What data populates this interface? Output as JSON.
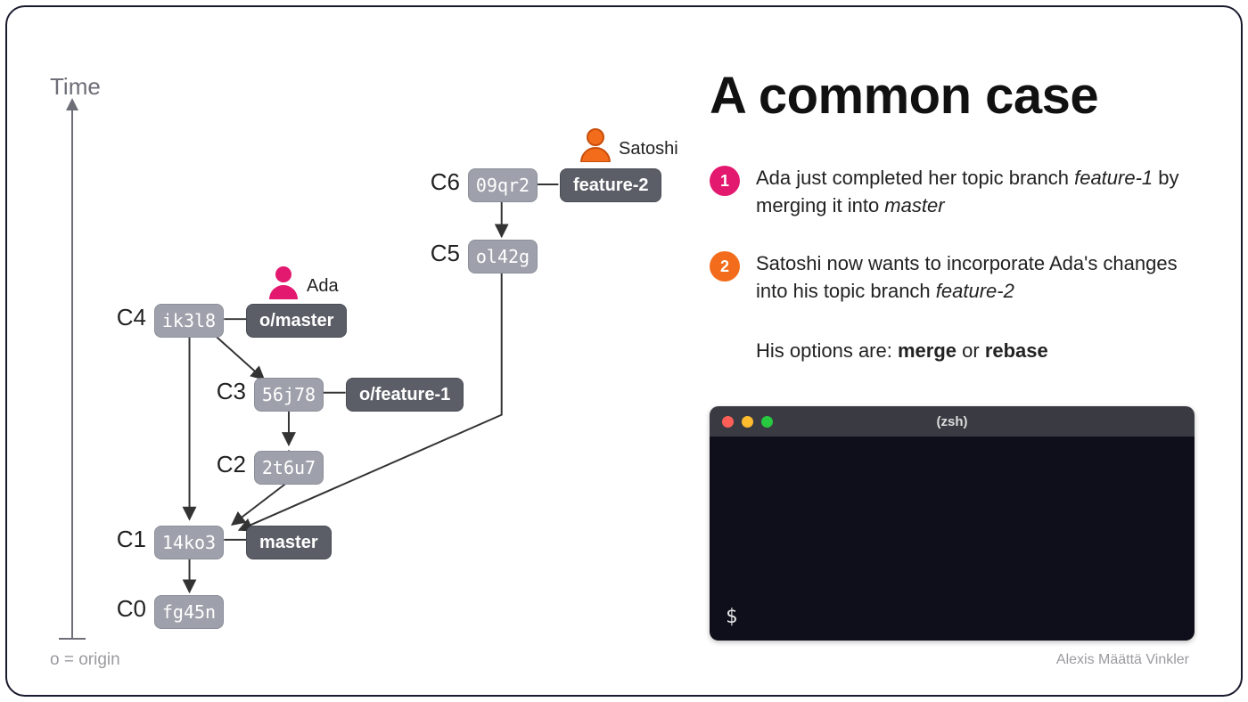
{
  "axis": {
    "label": "Time",
    "originNote": "o = origin"
  },
  "commits": {
    "c0": {
      "label": "C0",
      "hash": "fg45n"
    },
    "c1": {
      "label": "C1",
      "hash": "14ko3"
    },
    "c2": {
      "label": "C2",
      "hash": "2t6u7"
    },
    "c3": {
      "label": "C3",
      "hash": "56j78"
    },
    "c4": {
      "label": "C4",
      "hash": "ik3l8"
    },
    "c5": {
      "label": "C5",
      "hash": "ol42g"
    },
    "c6": {
      "label": "C6",
      "hash": "09qr2"
    }
  },
  "branches": {
    "master": "master",
    "oMaster": "o/master",
    "oFeature1": "o/feature-1",
    "feature2": "feature-2"
  },
  "people": {
    "ada": "Ada",
    "satoshi": "Satoshi"
  },
  "title": "A common case",
  "steps": {
    "s1": {
      "num": "1",
      "pre": "Ada just completed her topic branch ",
      "em1": "feature-1",
      "mid": " by merging it into ",
      "em2": "master"
    },
    "s2": {
      "num": "2",
      "pre": "Satoshi now wants to incorporate Ada's changes into his topic branch ",
      "em1": "feature-2"
    },
    "s3": {
      "pre": "His options are: ",
      "b1": "merge",
      "or": " or ",
      "b2": "rebase"
    }
  },
  "terminal": {
    "title": "(zsh)",
    "prompt": "$"
  },
  "credit": "Alexis Määttä Vinkler"
}
